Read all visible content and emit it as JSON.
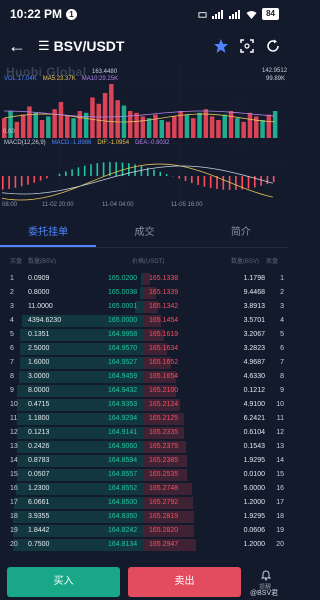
{
  "status": {
    "time": "10:22 PM",
    "notif_count": "1",
    "battery": "84"
  },
  "nav": {
    "title": "BSV/USDT"
  },
  "chart": {
    "watermark": "Huobi Global",
    "indicators": {
      "vol": "VOL:17.04K",
      "ma5": "MA5:23.37K",
      "ma10": "MA10:29.25K"
    },
    "macd": {
      "label": "MACD(12,26,9)",
      "macd": "MACD:-1.8986",
      "dif": "DIF:-1.0954",
      "dea": "DEA:-0.8032"
    },
    "price_high": "163.4480",
    "price_right_top": "142.9512",
    "price_right_sub": "99.89K",
    "price_left_low": "0.00",
    "time_labels": [
      "08:00",
      "11-02 20:00",
      "11-04 04:00",
      "11-05 16:00"
    ],
    "colors": {
      "up": "#21c6a0",
      "down": "#ff4c5e",
      "accent": "#4f86ff"
    }
  },
  "tabs": [
    {
      "label": "委托挂单",
      "active": true
    },
    {
      "label": "成交",
      "active": false
    },
    {
      "label": "简介",
      "active": false
    }
  ],
  "book_header": {
    "idx": "买盘",
    "bid_qty": "数量(BSV)",
    "price": "价格(USDT)",
    "ask_qty": "数量(BSV)",
    "ask_idx": "卖盘"
  },
  "orderbook": [
    {
      "i": "1",
      "bid_qty": "0.0909",
      "bid_price": "165.0200",
      "ask_price": "165.1338",
      "ask_qty": "1.1798",
      "ai": "1",
      "bd": 0.02,
      "ad": 0.04
    },
    {
      "i": "2",
      "bid_qty": "0.8000",
      "bid_price": "165.0038",
      "ask_price": "165.1339",
      "ask_qty": "9.4468",
      "ai": "2",
      "bd": 0.03,
      "ad": 0.08
    },
    {
      "i": "3",
      "bid_qty": "11.0000",
      "bid_price": "165.0001",
      "ask_price": "165.1342",
      "ask_qty": "3.8913",
      "ai": "3",
      "bd": 0.06,
      "ad": 0.1
    },
    {
      "i": "4",
      "bid_qty": "4394.6230",
      "bid_price": "165.0000",
      "ask_price": "165.1454",
      "ask_qty": "3.5701",
      "ai": "4",
      "bd": 0.85,
      "ad": 0.12
    },
    {
      "i": "5",
      "bid_qty": "0.1351",
      "bid_price": "164.9958",
      "ask_price": "165.1619",
      "ask_qty": "3.2067",
      "ai": "5",
      "bd": 0.86,
      "ad": 0.14
    },
    {
      "i": "6",
      "bid_qty": "2.5000",
      "bid_price": "164.9570",
      "ask_price": "165.1634",
      "ask_qty": "3.2823",
      "ai": "6",
      "bd": 0.86,
      "ad": 0.16
    },
    {
      "i": "7",
      "bid_qty": "1.6000",
      "bid_price": "164.9527",
      "ask_price": "165.1652",
      "ask_qty": "4.9687",
      "ai": "7",
      "bd": 0.86,
      "ad": 0.19
    },
    {
      "i": "8",
      "bid_qty": "3.0000",
      "bid_price": "164.9459",
      "ask_price": "165.1654",
      "ask_qty": "4.6330",
      "ai": "8",
      "bd": 0.87,
      "ad": 0.22
    },
    {
      "i": "9",
      "bid_qty": "8.0000",
      "bid_price": "164.9432",
      "ask_price": "165.2100",
      "ask_qty": "0.1212",
      "ai": "9",
      "bd": 0.88,
      "ad": 0.22
    },
    {
      "i": "10",
      "bid_qty": "0.4715",
      "bid_price": "164.9353",
      "ask_price": "165.2124",
      "ask_qty": "4.9100",
      "ai": "10",
      "bd": 0.88,
      "ad": 0.25
    },
    {
      "i": "11",
      "bid_qty": "1.1800",
      "bid_price": "164.9294",
      "ask_price": "165.2125",
      "ask_qty": "6.2421",
      "ai": "11",
      "bd": 0.88,
      "ad": 0.28
    },
    {
      "i": "12",
      "bid_qty": "0.1213",
      "bid_price": "164.9141",
      "ask_price": "165.2335",
      "ask_qty": "0.6104",
      "ai": "12",
      "bd": 0.88,
      "ad": 0.28
    },
    {
      "i": "13",
      "bid_qty": "0.2426",
      "bid_price": "164.9060",
      "ask_price": "165.2375",
      "ask_qty": "0.1543",
      "ai": "13",
      "bd": 0.88,
      "ad": 0.29
    },
    {
      "i": "14",
      "bid_qty": "0.8783",
      "bid_price": "164.8594",
      "ask_price": "165.2385",
      "ask_qty": "1.9295",
      "ai": "14",
      "bd": 0.88,
      "ad": 0.3
    },
    {
      "i": "15",
      "bid_qty": "0.0507",
      "bid_price": "164.8557",
      "ask_price": "165.2535",
      "ask_qty": "0.0100",
      "ai": "15",
      "bd": 0.88,
      "ad": 0.3
    },
    {
      "i": "16",
      "bid_qty": "1.2300",
      "bid_price": "164.8552",
      "ask_price": "165.2748",
      "ask_qty": "5.0000",
      "ai": "16",
      "bd": 0.89,
      "ad": 0.33
    },
    {
      "i": "17",
      "bid_qty": "6.0661",
      "bid_price": "164.8500",
      "ask_price": "165.2792",
      "ask_qty": "1.2000",
      "ai": "17",
      "bd": 0.9,
      "ad": 0.34
    },
    {
      "i": "18",
      "bid_qty": "3.9355",
      "bid_price": "164.8350",
      "ask_price": "165.2819",
      "ask_qty": "1.9295",
      "ai": "18",
      "bd": 0.91,
      "ad": 0.35
    },
    {
      "i": "19",
      "bid_qty": "1.8442",
      "bid_price": "164.8242",
      "ask_price": "165.2820",
      "ask_qty": "0.0606",
      "ai": "19",
      "bd": 0.91,
      "ad": 0.35
    },
    {
      "i": "20",
      "bid_qty": "0.7500",
      "bid_price": "164.8134",
      "ask_price": "165.2947",
      "ask_qty": "1.2000",
      "ai": "20",
      "bd": 0.91,
      "ad": 0.36
    }
  ],
  "bottom": {
    "buy": "买入",
    "sell": "卖出",
    "alert": "提醒",
    "credit": "@BSV君"
  }
}
